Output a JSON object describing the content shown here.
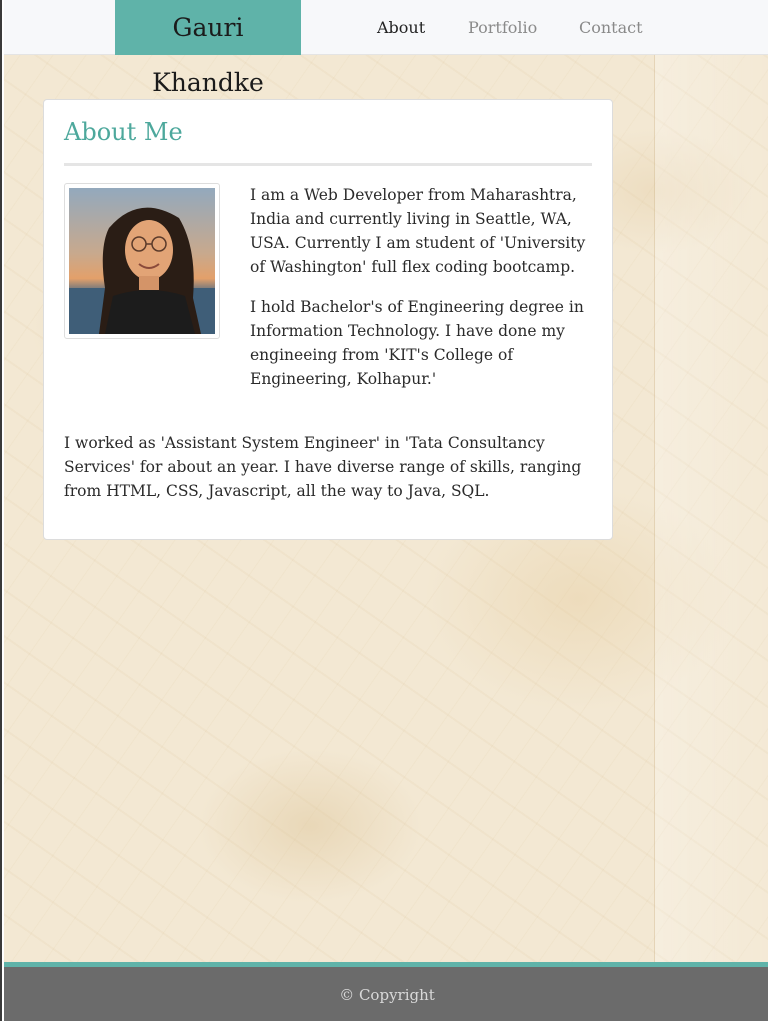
{
  "header": {
    "brand": "Gauri Khandke",
    "nav": [
      {
        "label": "About"
      },
      {
        "label": "Portfolio"
      },
      {
        "label": "Contact"
      }
    ]
  },
  "about": {
    "title": "About Me",
    "paragraphs": [
      "I am a Web Developer from Maharashtra, India and currently living in Seattle, WA, USA. Currently I am student of 'University of Washington' full flex coding bootcamp.",
      "I hold Bachelor's of Engineering degree in Information Technology. I have done my engineeing from 'KIT's College of Engineering, Kolhapur.'",
      "I worked as 'Assistant System Engineer' in 'Tata Consultancy Services' for about an year. I have diverse range of skills, ranging from HTML, CSS, Javascript, all the way to Java, SQL."
    ]
  },
  "footer": {
    "copyright": "© Copyright"
  },
  "colors": {
    "accent": "#5fb3a9",
    "title": "#4da89c",
    "footer_bg": "#6b6b6b",
    "nav_bg": "#f7f8fa"
  }
}
